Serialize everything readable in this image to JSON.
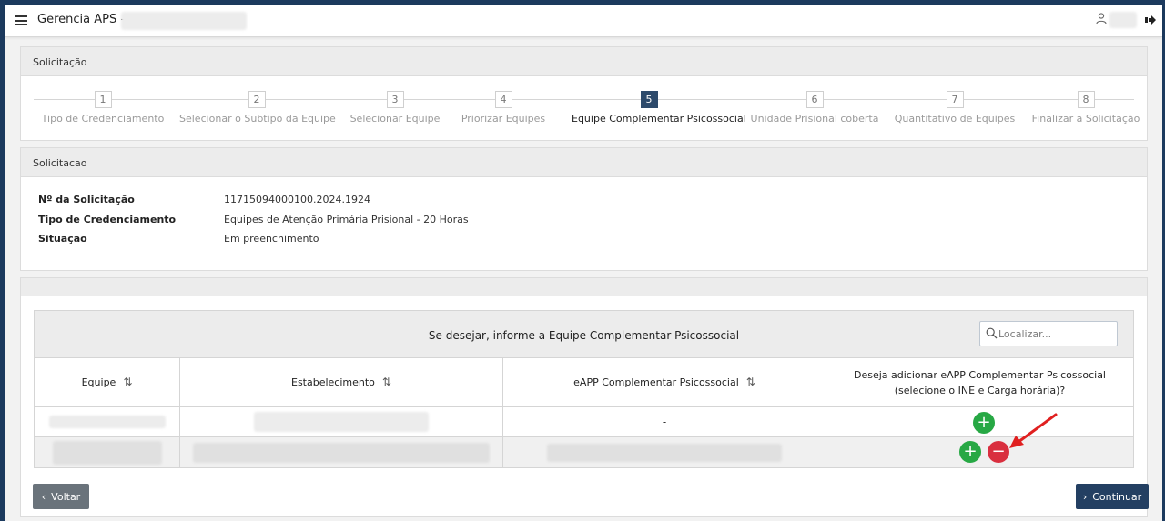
{
  "topbar": {
    "title": "Gerencia APS -"
  },
  "steps_panel": {
    "header": "Solicitação",
    "steps": [
      {
        "num": "1",
        "label": "Tipo de Credenciamento"
      },
      {
        "num": "2",
        "label": "Selecionar o Subtipo da Equipe"
      },
      {
        "num": "3",
        "label": "Selecionar Equipe"
      },
      {
        "num": "4",
        "label": "Priorizar Equipes"
      },
      {
        "num": "5",
        "label": "Equipe Complementar Psicossocial"
      },
      {
        "num": "6",
        "label": "Unidade Prisional coberta"
      },
      {
        "num": "7",
        "label": "Quantitativo de Equipes"
      },
      {
        "num": "8",
        "label": "Finalizar a Solicitação"
      }
    ],
    "active_step": 5
  },
  "info_panel": {
    "header": "Solicitacao",
    "rows": [
      {
        "label": "Nº da Solicitação",
        "value": "11715094000100.2024.1924"
      },
      {
        "label": "Tipo de Credenciamento",
        "value": "Equipes de Atenção Primária Prisional - 20 Horas"
      },
      {
        "label": "Situação",
        "value": "Em preenchimento"
      }
    ]
  },
  "table": {
    "caption": "Se desejar, informe a Equipe Complementar Psicossocial",
    "search_placeholder": "Localizar...",
    "columns": [
      "Equipe",
      "Estabelecimento",
      "eAPP Complementar Psicossocial",
      "Deseja adicionar eAPP Complementar Psicossocial (selecione o INE e Carga horária)?"
    ],
    "row1": {
      "eapp": "-"
    }
  },
  "buttons": {
    "voltar": "Voltar",
    "continuar": "Continuar"
  },
  "colors": {
    "primary": "#233f62",
    "active_step": "#2d4a6b",
    "add": "#27a844",
    "remove": "#d92f3f",
    "secondary": "#6a737b"
  }
}
